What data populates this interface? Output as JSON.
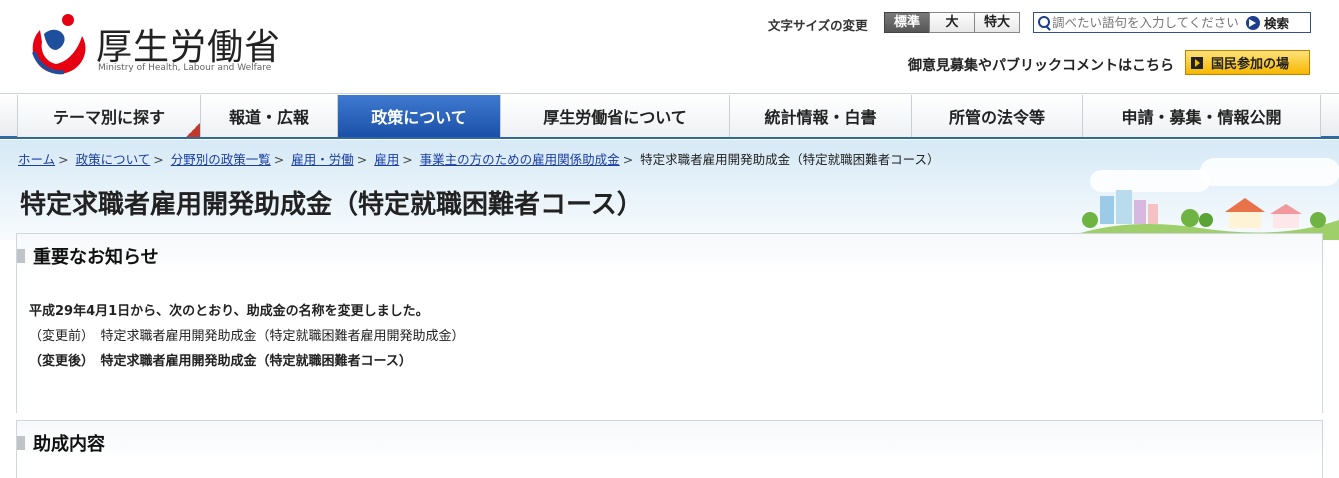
{
  "header": {
    "logo_ja": "厚生労働省",
    "logo_en": "Ministry of Health, Labour and Welfare",
    "font_size_label": "文字サイズの変更",
    "font_sizes": [
      "標準",
      "大",
      "特大"
    ],
    "search_placeholder": "調べたい語句を入力してください",
    "search_button": "検索",
    "opinion_link": "御意見募集やパブリックコメントはこちら",
    "participate_button": "国民参加の場"
  },
  "nav": {
    "items": [
      "テーマ別に探す",
      "報道・広報",
      "政策について",
      "厚生労働省について",
      "統計情報・白書",
      "所管の法令等",
      "申請・募集・情報公開"
    ],
    "active": "政策について"
  },
  "breadcrumb": {
    "items": [
      "ホーム",
      "政策について",
      "分野別の政策一覧",
      "雇用・労働",
      "雇用",
      "事業主の方のための雇用関係助成金"
    ],
    "current": "特定求職者雇用開発助成金（特定就職困難者コース）"
  },
  "page_title": "特定求職者雇用開発助成金（特定就職困難者コース）",
  "sections": {
    "notice_title": "重要なお知らせ",
    "notice_lines": [
      "平成29年4月1日から、次のとおり、助成金の名称を変更しました。",
      "（変更前）　特定求職者雇用開発助成金（特定就職困難者雇用開発助成金）",
      "（変更後）　特定求職者雇用開発助成金（特定就職困難者コース）"
    ],
    "content_title": "助成内容"
  },
  "colors": {
    "nav_active": "#1b4fa8",
    "link": "#1a3ea5",
    "participate": "#f6b700"
  }
}
